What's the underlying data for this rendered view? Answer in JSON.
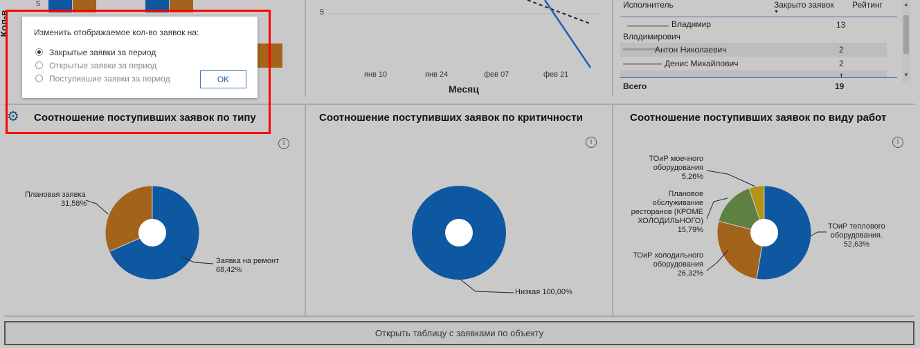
{
  "top_left_chart": {
    "y_axis_label": "Кол-в",
    "y_tick": "5"
  },
  "line_chart": {
    "y_tick": "5",
    "x_ticks": [
      "янв 10",
      "янв 24",
      "фев 07",
      "фев 21"
    ],
    "x_axis_title": "Месяц"
  },
  "table": {
    "headers": {
      "performer": "Исполнитель",
      "closed": "Закрыто заявок",
      "rating": "Рейтинг"
    },
    "rows": [
      {
        "name_line1": "Владимир",
        "name_line2": "Владимирович",
        "closed": "13"
      },
      {
        "name": "Антон Николаевич",
        "closed": "2"
      },
      {
        "name": "Денис Михайлович",
        "closed": "2"
      },
      {
        "closed": "1"
      }
    ],
    "total_label": "Всего",
    "total_value": "19"
  },
  "popup": {
    "title": "Изменить отображаемое кол-во заявок  на:",
    "options": [
      "Закрытые заявки за период",
      "Открытые заявки за период",
      "Поступившие заявки за период"
    ],
    "selected_index": 0,
    "ok_label": "OK"
  },
  "panels": {
    "type": {
      "title": "Соотношение поступивших заявок по типу",
      "labels": [
        {
          "line1": "Плановая заявка",
          "line2": "31,58%"
        },
        {
          "line1": "Заявка на ремонт",
          "line2": "68,42%"
        }
      ]
    },
    "criticality": {
      "title": "Соотношение поступивших заявок по критичности",
      "labels": [
        {
          "line1": "Низкая 100,00%"
        }
      ]
    },
    "work": {
      "title": "Соотношение поступивших заявок по виду работ",
      "labels": [
        {
          "lines": [
            "ТОиР моечного",
            "оборудования",
            "5,26%"
          ]
        },
        {
          "lines": [
            "Плановое",
            "обслуживание",
            "ресторанов (КРОМЕ",
            "ХОЛОДИЛЬНОГО)",
            "15,79%"
          ]
        },
        {
          "lines": [
            "ТОиР холодильного",
            "оборудования",
            "26,32%"
          ]
        },
        {
          "lines": [
            "ТОиР теплового",
            "оборудования.",
            "52,63%"
          ]
        }
      ]
    }
  },
  "chart_data": [
    {
      "type": "pie",
      "labels": [
        "Заявка на ремонт",
        "Плановая заявка"
      ],
      "values": [
        68.42,
        31.58
      ],
      "colors": [
        "#0d58a1",
        "#a2631b"
      ]
    },
    {
      "type": "pie",
      "labels": [
        "Низкая"
      ],
      "values": [
        100.0
      ],
      "colors": [
        "#0d58a1"
      ]
    },
    {
      "type": "pie",
      "labels": [
        "ТОиР теплового оборудования.",
        "ТОиР холодильного оборудования",
        "Плановое обслуживание ресторанов (КРОМЕ ХОЛОДИЛЬНОГО)",
        "ТОиР моечного оборудования"
      ],
      "values": [
        52.63,
        26.32,
        15.79,
        5.26
      ],
      "colors": [
        "#0d58a1",
        "#a2631b",
        "#5e8040",
        "#b39317"
      ]
    }
  ],
  "bottom_button": {
    "label": "Открыть таблицу с заявками по объекту"
  },
  "icons": {
    "settings": "gear-icon",
    "info": "info-icon",
    "sort": "sort-down-icon"
  },
  "info_glyph": "i"
}
